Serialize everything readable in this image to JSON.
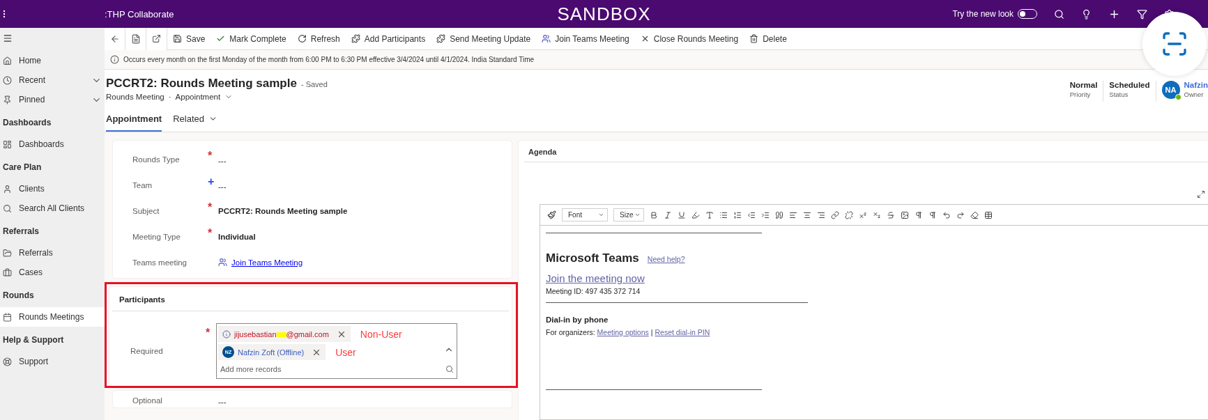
{
  "top_bar": {
    "app_name": ":THP Collaborate",
    "environment": "SANDBOX",
    "new_look": {
      "label": "Try the new look",
      "on": false
    }
  },
  "sidebar": {
    "sections": [
      {
        "items": [
          {
            "label": "Home",
            "expandable": false,
            "selected": false
          },
          {
            "label": "Recent",
            "expandable": true,
            "selected": false
          },
          {
            "label": "Pinned",
            "expandable": true,
            "selected": false
          }
        ]
      },
      {
        "title": "Dashboards",
        "items": [
          {
            "label": "Dashboards",
            "expandable": false,
            "selected": false
          }
        ]
      },
      {
        "title": "Care Plan",
        "items": [
          {
            "label": "Clients",
            "expandable": false,
            "selected": false
          },
          {
            "label": "Search All Clients",
            "expandable": false,
            "selected": false
          }
        ]
      },
      {
        "title": "Referrals",
        "items": [
          {
            "label": "Referrals",
            "expandable": false,
            "selected": false
          },
          {
            "label": "Cases",
            "expandable": false,
            "selected": false
          }
        ]
      },
      {
        "title": "Rounds",
        "items": [
          {
            "label": "Rounds Meetings",
            "expandable": false,
            "selected": true
          }
        ]
      },
      {
        "title": "Help & Support",
        "items": [
          {
            "label": "Support",
            "expandable": false,
            "selected": false
          }
        ]
      }
    ]
  },
  "command_bar": [
    {
      "label": "Save"
    },
    {
      "label": "Mark Complete"
    },
    {
      "label": "Refresh"
    },
    {
      "label": "Add Participants"
    },
    {
      "label": "Send Meeting Update"
    },
    {
      "label": "Join Teams Meeting"
    },
    {
      "label": "Close Rounds Meeting"
    },
    {
      "label": "Delete"
    }
  ],
  "notice": "Occurs every month on the first Monday of the month from 6:00 PM to 6:30 PM effective 3/4/2024 until 4/1/2024. India Standard Time",
  "record": {
    "title": "PCCRT2: Rounds Meeting sample",
    "save_state": "- Saved",
    "entity": "Rounds Meeting",
    "separator": "·",
    "form": "Appointment",
    "header_fields": [
      {
        "value": "Normal",
        "label": "Priority"
      },
      {
        "value": "Scheduled",
        "label": "Status"
      }
    ],
    "owner": {
      "initials": "NA",
      "name": "Nafzin",
      "label": "Owner",
      "online": true
    }
  },
  "tabs": [
    {
      "label": "Appointment",
      "selected": true,
      "dropdown": false
    },
    {
      "label": "Related",
      "selected": false,
      "dropdown": true
    }
  ],
  "general_fields": [
    {
      "label": "Rounds Type",
      "marker": "*",
      "color": "#d13438",
      "kind": "empty",
      "value": "---"
    },
    {
      "label": "Team",
      "marker": "+",
      "color": "#2b44ff",
      "kind": "empty",
      "value": "---"
    },
    {
      "label": "Subject",
      "marker": "*",
      "color": "#d13438",
      "kind": "text",
      "value": "PCCRT2: Rounds Meeting sample"
    },
    {
      "label": "Meeting Type",
      "marker": "*",
      "color": "#d13438",
      "kind": "text",
      "value": "Individual"
    },
    {
      "label": "Teams meeting",
      "kind": "link",
      "value": "Join Teams Meeting"
    }
  ],
  "participants": {
    "title": "Participants",
    "highlighted": true,
    "required": {
      "label": "Required",
      "marker": "*",
      "color": "#d13438",
      "placeholder": "Add more records",
      "chips": [
        {
          "kind": "unresolved",
          "text_start": "jijusebastian",
          "redacted": true,
          "text_end": "@gmail.com",
          "annotation": "Non-User"
        },
        {
          "kind": "user",
          "initials": "NZ",
          "text_start": "Nafzin Zoft (Offline)",
          "redacted": false,
          "annotation": "User"
        }
      ]
    },
    "optional": {
      "label": "Optional",
      "value": "---"
    }
  },
  "agenda": {
    "title": "Agenda",
    "font": "Font",
    "size": "Size",
    "content": [
      {
        "kind": "rule"
      },
      {
        "kind": "heading",
        "text": "Microsoft Teams",
        "link": "Need help?"
      },
      {
        "kind": "big_link",
        "text": "Join the meeting now"
      },
      {
        "kind": "text",
        "text": "Meeting ID: 497 435 372 714"
      },
      {
        "kind": "short_rule"
      },
      {
        "kind": "subheading",
        "text": "Dial-in by phone"
      },
      {
        "kind": "links",
        "text": "For organizers:",
        "links": [
          "Meeting options",
          "Reset dial-in PIN"
        ],
        "separator": "|"
      },
      {
        "kind": "spacer"
      },
      {
        "kind": "rule"
      }
    ]
  }
}
